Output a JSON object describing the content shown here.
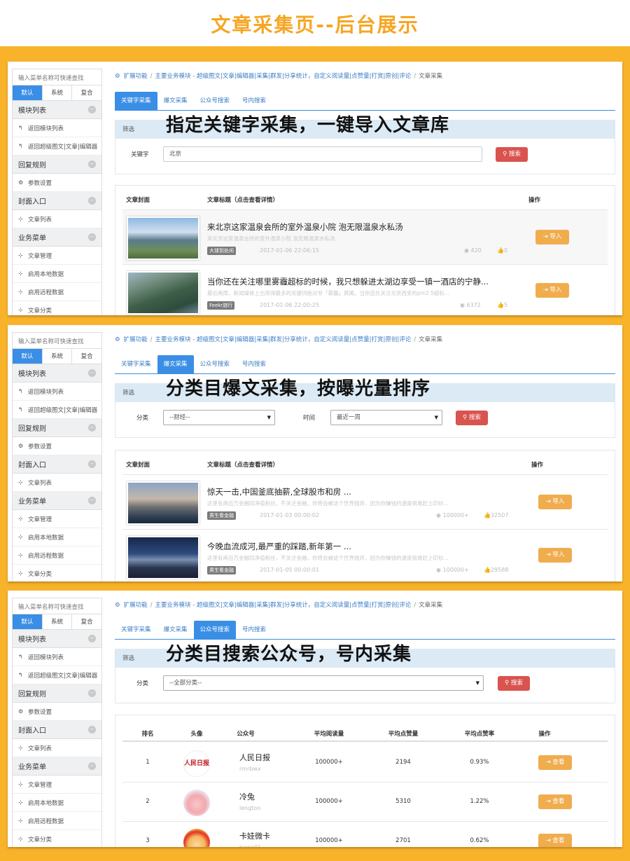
{
  "banner_title": "文章采集页--后台展示",
  "sidebar": {
    "search_placeholder": "输入菜单名称可快速查找",
    "tabs": [
      "默认",
      "系统",
      "复合"
    ],
    "groups": [
      {
        "label": "模块列表",
        "items": [
          "返回模块列表",
          "返回超级图文|文章|编辑器"
        ]
      },
      {
        "label": "回复规则",
        "items": [
          "参数设置"
        ]
      },
      {
        "label": "封面入口",
        "items": [
          "文章列表"
        ]
      },
      {
        "label": "业务菜单",
        "items": [
          "文章管理",
          "启用本地数据",
          "启用远程数据",
          "文章分类"
        ]
      }
    ]
  },
  "breadcrumb": {
    "items": [
      "扩展功能",
      "主要业务模块 - 超级图文|文章|编辑器|采集|群发|分享统计，自定义阅读量|点赞量|打赏|原创|评论"
    ],
    "current": "文章采集"
  },
  "page_tabs": [
    "关键字采集",
    "爆文采集",
    "公众号搜索",
    "号内搜索"
  ],
  "filter_label": "筛选",
  "search_button": "搜索",
  "import_button": "导入",
  "view_button": "查看",
  "panel1": {
    "overlay": "指定关键字采集，一键导入文章库",
    "keyword_label": "关键字",
    "keyword_value": "北京",
    "col_cover": "文章封面",
    "col_title": "文章标题（点击查看详情）",
    "col_action": "操作",
    "articles": [
      {
        "title": "来北京这家温泉会所的室外温泉小院 泡无限温泉水私汤",
        "summary": "来北京这家温泉会所的室外温泉小院 泡无限温泉水私汤",
        "source": "大球到处闲",
        "date": "2017-01-06 22:06:15",
        "views": "420",
        "likes": "0"
      },
      {
        "title": "当你还在关注哪里雾霾超标的时候，我只想躲进太湖边享受一镇一酒店的宁静...",
        "summary": "最近两周，新闻媒体上出现得最多的关键词绝对非「雾霾」莫属。当你还在关注北京西安的pm2.5超标...",
        "source": "Feekr旅行",
        "date": "2017-01-06 22:00:25",
        "views": "6372",
        "likes": "5"
      }
    ]
  },
  "panel2": {
    "overlay": "分类目爆文采集，按曝光量排序",
    "category_label": "分类",
    "category_value": "--财经--",
    "time_label": "时间",
    "time_value": "最近一周",
    "col_cover": "文章封面",
    "col_title": "文章标题（点击查看详情）",
    "col_action": "操作",
    "articles": [
      {
        "title": "惊天一击,中国釜底抽薪,全球股市和房 ...",
        "summary": "这里有两百万金融同净值粉丝，不关注金融，你将会被这个世界抛弃，因为你赚钱的速度很难赶上印钞...",
        "source": "男生看金融",
        "date": "2017-01-03 00:00:02",
        "views": "100000+",
        "likes": "32507"
      },
      {
        "title": "今晚血流成河,最严重的踩踏,新年第一 ...",
        "summary": "这里有两百万金融同净值粉丝，不关注金融，你将会被这个世界抛弃，因为你赚钱的速度很难赶上印钞...",
        "source": "男生看金融",
        "date": "2017-01-05 00:00:01",
        "views": "100000+",
        "likes": "29588"
      }
    ]
  },
  "panel3": {
    "overlay": "分类目搜索公众号，号内采集",
    "category_label": "分类",
    "category_value": "--全部分类--",
    "columns": [
      "排名",
      "头像",
      "公众号",
      "平均阅读量",
      "平均点赞量",
      "平均点赞率",
      "操作"
    ],
    "rows": [
      {
        "rank": "1",
        "name": "人民日报",
        "id": "rmrbwx",
        "reads": "100000+",
        "likes": "2194",
        "rate": "0.93%",
        "logo": "人民日报"
      },
      {
        "rank": "2",
        "name": "冷兔",
        "id": "lengtoo",
        "reads": "100000+",
        "likes": "5310",
        "rate": "1.22%"
      },
      {
        "rank": "3",
        "name": "卡娃微卡",
        "id": "kawa01",
        "reads": "100000+",
        "likes": "2701",
        "rate": "0.62%"
      }
    ]
  },
  "colors": {
    "accent": "#3a8ee6",
    "banner": "#f6a623",
    "frame": "#f8b32b",
    "danger": "#d9534f",
    "warning": "#f0ad4e"
  }
}
